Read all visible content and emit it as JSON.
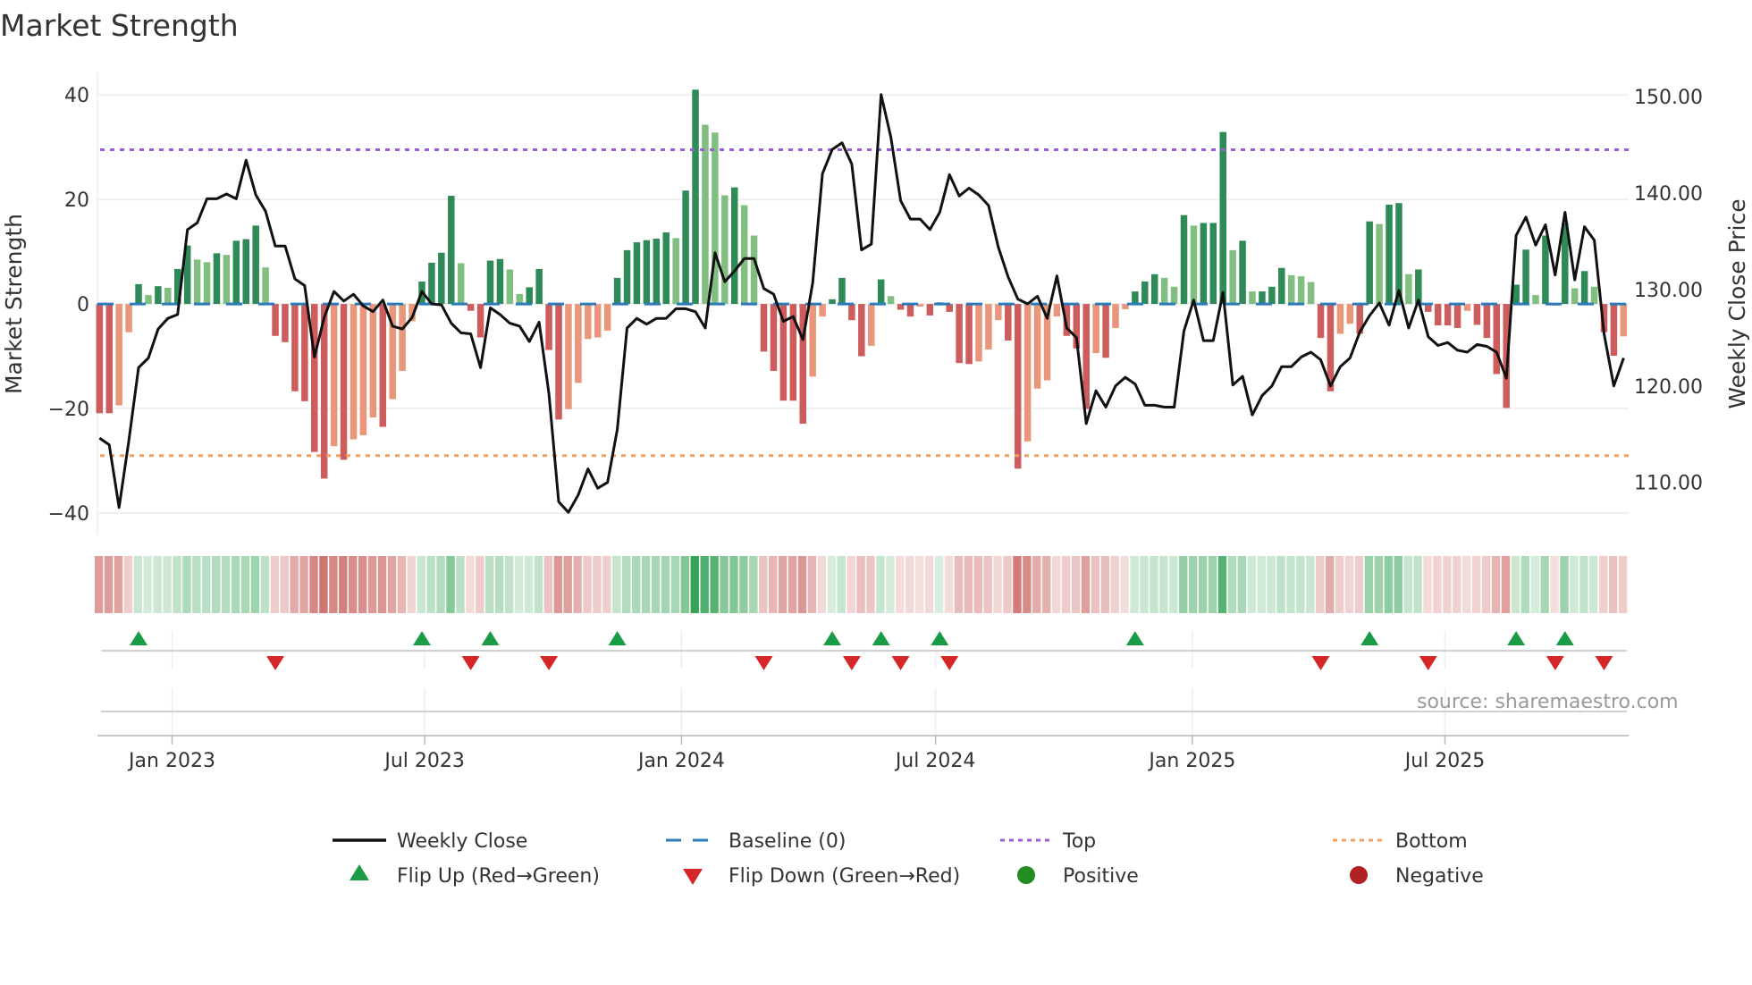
{
  "chart_data": {
    "type": "bar",
    "title": "Market Strength",
    "ylabel": "Market Strength",
    "y2label": "Weekly Close Price",
    "x_start": "2022-11-10",
    "x_step_days": 7,
    "ylim": [
      -44.1,
      44.3
    ],
    "y2lim": [
      104.6,
      152.5
    ],
    "yticks": [
      {
        "v": 40,
        "label": "40"
      },
      {
        "v": 20,
        "label": "20"
      },
      {
        "v": 0,
        "label": "0"
      },
      {
        "v": -20,
        "label": "−20"
      },
      {
        "v": -40,
        "label": "−40"
      }
    ],
    "y2ticks": [
      {
        "v": 150,
        "label": "150.00"
      },
      {
        "v": 140,
        "label": "140.00"
      },
      {
        "v": 130,
        "label": "130.00"
      },
      {
        "v": 120,
        "label": "120.00"
      },
      {
        "v": 110,
        "label": "110.00"
      }
    ],
    "xticks": [
      {
        "date": "2023-01-01",
        "label": "Jan 2023"
      },
      {
        "date": "2023-07-01",
        "label": "Jul 2023"
      },
      {
        "date": "2024-01-01",
        "label": "Jan 2024"
      },
      {
        "date": "2024-07-01",
        "label": "Jul 2024"
      },
      {
        "date": "2025-01-01",
        "label": "Jan 2025"
      },
      {
        "date": "2025-07-01",
        "label": "Jul 2025"
      }
    ],
    "top_level": 29.5,
    "bottom_level": -29,
    "baseline": 0,
    "strength": [
      -20.9,
      -20.9,
      -19.4,
      -5.4,
      3.8,
      1.7,
      3.4,
      3.1,
      6.7,
      11.2,
      8.5,
      8.0,
      9.7,
      9.4,
      12.1,
      12.4,
      15.0,
      7.0,
      -6.1,
      -7.3,
      -16.7,
      -18.6,
      -28.3,
      -33.4,
      -27.2,
      -29.8,
      -25.9,
      -25.1,
      -21.7,
      -23.5,
      -18.2,
      -12.8,
      -3.3,
      4.3,
      7.9,
      9.8,
      20.7,
      7.8,
      -1.3,
      -6.4,
      8.3,
      8.6,
      6.6,
      1.9,
      3.2,
      6.7,
      -8.8,
      -22.1,
      -20.1,
      -15.1,
      -6.7,
      -6.4,
      -5.1,
      5.0,
      10.3,
      11.8,
      12.2,
      12.5,
      13.7,
      12.6,
      21.7,
      41.0,
      34.3,
      32.8,
      20.8,
      22.3,
      18.9,
      13.1,
      -9.1,
      -12.8,
      -18.5,
      -18.5,
      -22.9,
      -13.9,
      -2.4,
      0.9,
      5.0,
      -3.1,
      -10.0,
      -8.0,
      4.7,
      1.5,
      -1.1,
      -2.4,
      -0.5,
      -2.2,
      0.3,
      -1.5,
      -11.3,
      -11.5,
      -11.0,
      -8.7,
      -3.1,
      -7.0,
      -31.5,
      -26.3,
      -16.2,
      -14.6,
      -2.4,
      -6.1,
      -8.5,
      -20.1,
      -9.4,
      -10.3,
      -4.6,
      -1.0,
      2.4,
      4.3,
      5.7,
      5.0,
      3.3,
      17.0,
      15.0,
      15.5,
      15.5,
      32.9,
      10.3,
      12.1,
      2.4,
      2.4,
      3.3,
      6.9,
      5.5,
      5.3,
      4.2,
      -6.5,
      -16.7,
      -5.7,
      -3.8,
      -5.7,
      15.8,
      15.3,
      19.0,
      19.3,
      5.7,
      6.6,
      -1.5,
      -4.1,
      -4.1,
      -4.6,
      -1.3,
      -4.0,
      -6.5,
      -13.4,
      -19.9,
      3.7,
      10.4,
      1.7,
      13.1,
      -0.3,
      15.5,
      3.0,
      6.3,
      3.3,
      -5.4,
      -9.9,
      -6.2
    ],
    "weekly_close": [
      114.6,
      113.9,
      107.4,
      114.3,
      121.9,
      122.9,
      125.9,
      127.0,
      127.4,
      136.2,
      136.9,
      139.4,
      139.4,
      139.9,
      139.4,
      143.4,
      139.8,
      138.1,
      134.5,
      134.5,
      131.1,
      130.4,
      123.0,
      127.1,
      129.8,
      128.8,
      129.5,
      128.3,
      127.7,
      128.9,
      126.2,
      125.9,
      127.1,
      129.8,
      128.5,
      128.4,
      126.5,
      125.5,
      125.4,
      121.9,
      128.1,
      127.4,
      126.5,
      126.2,
      124.6,
      126.6,
      119.2,
      108.0,
      106.9,
      108.7,
      111.4,
      109.4,
      110.0,
      115.5,
      126.0,
      127.0,
      126.4,
      127.0,
      127.0,
      128.0,
      128.0,
      127.7,
      126.0,
      133.8,
      130.8,
      131.9,
      133.2,
      133.2,
      130.1,
      129.5,
      126.7,
      127.2,
      124.8,
      130.7,
      142.0,
      144.5,
      145.2,
      143.0,
      134.1,
      134.7,
      150.2,
      145.8,
      139.2,
      137.3,
      137.3,
      136.2,
      138.0,
      141.9,
      139.7,
      140.5,
      139.8,
      138.7,
      134.4,
      131.3,
      129.0,
      128.5,
      129.3,
      127.0,
      131.4,
      126.0,
      125.0,
      116.1,
      119.5,
      117.8,
      120.0,
      120.9,
      120.2,
      118.0,
      118.0,
      117.8,
      117.8,
      125.7,
      128.9,
      124.7,
      124.7,
      129.7,
      120.1,
      121.0,
      117.0,
      119.0,
      120.0,
      122.0,
      122.0,
      123.0,
      123.5,
      122.7,
      120.0,
      122.0,
      122.9,
      125.6,
      127.3,
      128.6,
      126.3,
      129.9,
      126.0,
      128.9,
      125.1,
      124.2,
      124.5,
      123.7,
      123.5,
      124.3,
      124.1,
      123.5,
      120.8,
      135.6,
      137.5,
      134.6,
      136.7,
      131.5,
      138.0,
      131.0,
      136.5,
      135.1,
      125.4,
      120.0,
      122.9
    ],
    "legend": {
      "weekly_close": "Weekly Close",
      "baseline": "Baseline (0)",
      "top": "Top",
      "bottom": "Bottom",
      "flip_up": "Flip Up (Red→Green)",
      "flip_down": "Flip Down (Green→Red)",
      "positive": "Positive",
      "negative": "Negative"
    },
    "legend_placement": "bottom",
    "grid": true
  },
  "source": "source: sharemaestro.com",
  "colors": {
    "pos_strong": "#2e8b57",
    "pos_weak": "#80bf80",
    "neg_strong": "#cd5c5c",
    "neg_weak": "#e9967a",
    "baseline": "#2b7bba",
    "top": "#9b5cd6",
    "bottom": "#f0a060",
    "line": "#111111",
    "flip_up": "#1a9c46",
    "flip_down": "#d62728",
    "positive": "#228b22",
    "negative": "#b22222"
  }
}
